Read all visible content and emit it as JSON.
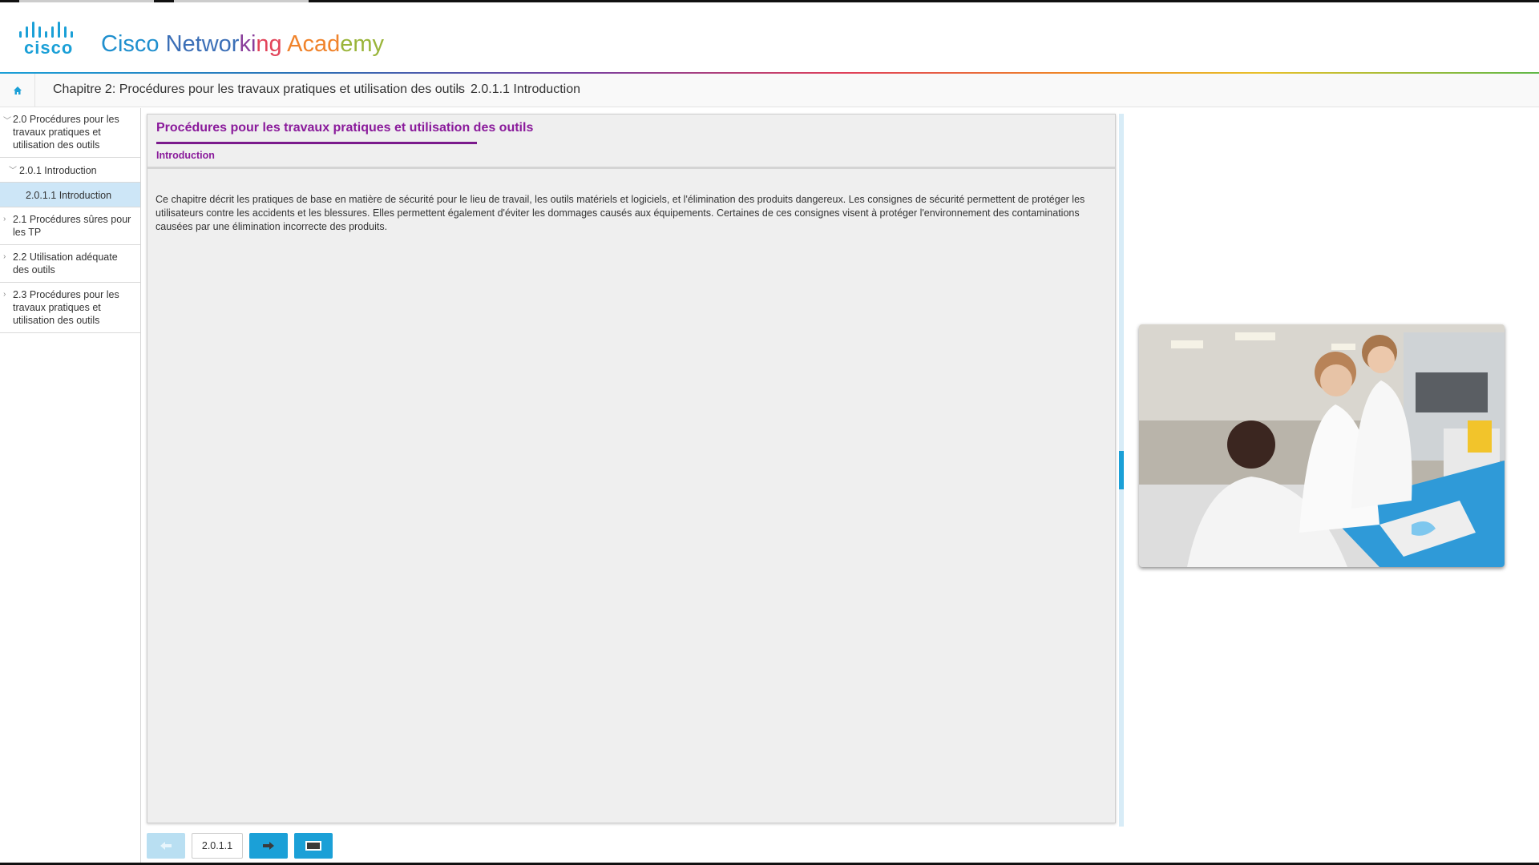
{
  "header": {
    "logo_text": "cisco",
    "brand_parts": [
      {
        "text": "Cisco ",
        "color": "#1f8fce"
      },
      {
        "text": "Networ",
        "color": "#3b6fb7"
      },
      {
        "text": "ki",
        "color": "#8a3e9c"
      },
      {
        "text": "ng ",
        "color": "#e2445a"
      },
      {
        "text": "Acad",
        "color": "#f0832b"
      },
      {
        "text": "emy",
        "color": "#9ab53a"
      }
    ]
  },
  "breadcrumb": {
    "home_icon": "home-icon",
    "chapter": "Chapitre 2: Procédures pour les travaux pratiques et utilisation des outils",
    "separator": "›",
    "current": "2.0.1.1 Introduction"
  },
  "sidebar": {
    "items": [
      {
        "label": "2.0 Procédures pour les travaux pratiques et utilisation des outils",
        "expanded": true
      },
      {
        "label": "2.0.1 Introduction",
        "expanded": true
      },
      {
        "label": "2.0.1.1 Introduction",
        "active": true
      },
      {
        "label": "2.1 Procédures sûres pour les TP",
        "expanded": false
      },
      {
        "label": "2.2 Utilisation adéquate des outils",
        "expanded": false
      },
      {
        "label": "2.3 Procédures pour les travaux pratiques et utilisation des outils",
        "expanded": false
      }
    ]
  },
  "content": {
    "title": "Procédures pour les travaux pratiques et utilisation des outils",
    "subtitle": "Introduction",
    "body": "Ce chapitre décrit les pratiques de base en matière de sécurité pour le lieu de travail, les outils matériels et logiciels, et l'élimination des produits dangereux. Les consignes de sécurité permettent de protéger les utilisateurs contre les accidents et les blessures. Elles permettent également d'éviter les dommages causés aux équipements. Certaines de ces consignes visent à protéger l'environnement des contaminations causées par une élimination incorrecte des produits."
  },
  "footer": {
    "page_number": "2.0.1.1",
    "prev_icon": "arrow-left-icon",
    "next_icon": "arrow-right-icon",
    "screen_icon": "screen-icon"
  },
  "colors": {
    "accent": "#1ba0d7",
    "title_purple": "#8a1a9b",
    "active_nav": "#cde6f7"
  }
}
